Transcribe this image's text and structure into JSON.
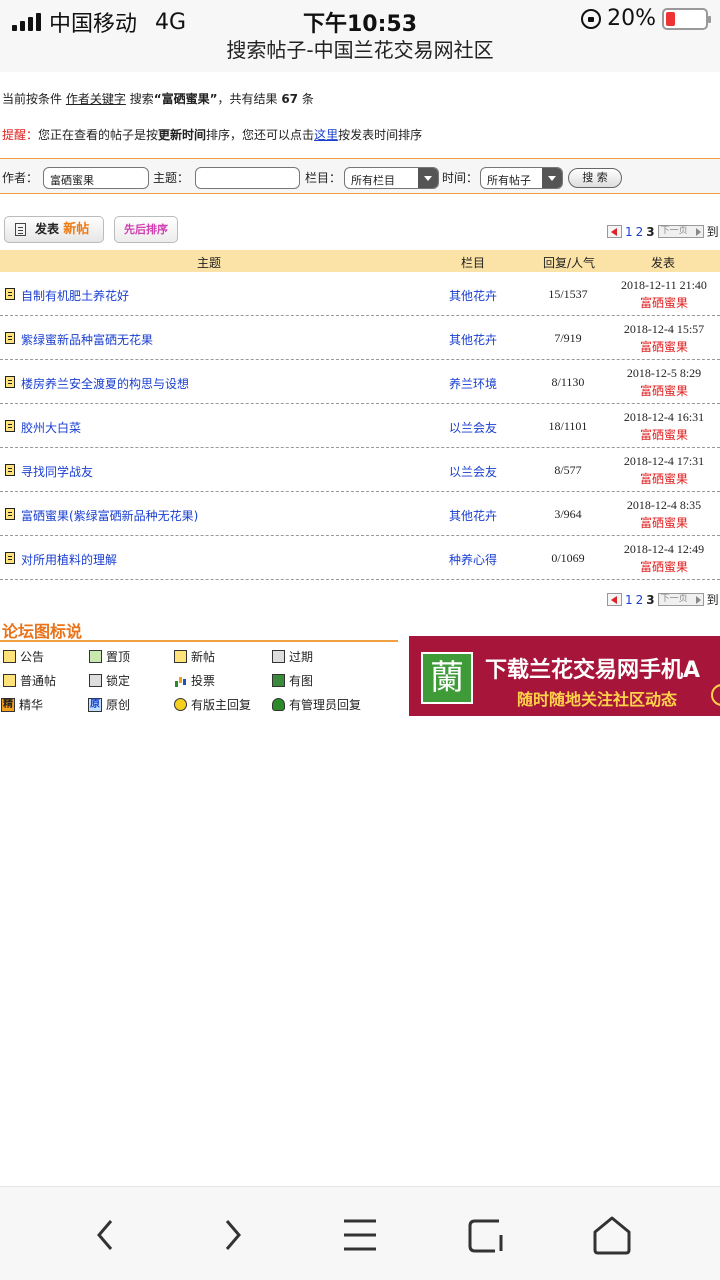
{
  "status_bar": {
    "carrier": "中国移动",
    "network": "4G",
    "time": "下午10:53",
    "battery": "20%"
  },
  "page_title": "搜索帖子-中国兰花交易网社区",
  "search_info": {
    "prefix": "当前按条件",
    "condition": "作者关键字",
    "search_word": "搜索",
    "keyword": "“富硒蜜果”",
    "result_prefix": "，共有结果",
    "count": "67",
    "unit": "条"
  },
  "tip": {
    "label": "提醒：",
    "text1": "您正在查看的帖子是按",
    "bold": "更新时间",
    "text2": "排序，您还可以点击",
    "link": "这里",
    "text3": "按发表时间排序"
  },
  "search_form": {
    "author_label": "作者：",
    "author_value": "富硒蜜果",
    "subject_label": "主题：",
    "subject_value": "",
    "column_label": "栏目：",
    "column_value": "所有栏目",
    "time_label": "时间：",
    "time_value": "所有帖子",
    "search_button": "搜 索"
  },
  "toolbar": {
    "post_label": "发表",
    "post_new": "新帖",
    "sort_label": "先后排序"
  },
  "pager": {
    "pages": [
      "1",
      "2",
      "3"
    ],
    "current": "3",
    "next_label": "下一页",
    "goto": "到"
  },
  "table": {
    "headers": {
      "subject": "主题",
      "column": "栏目",
      "stats": "回复/人气",
      "post": "发表"
    },
    "rows": [
      {
        "title": "自制有机肥土养花好",
        "column": "其他花卉",
        "stats": "15/1537",
        "date": "2018-12-11 21:40",
        "author": "富硒蜜果"
      },
      {
        "title": "紫绿蜜新品种富硒无花果",
        "column": "其他花卉",
        "stats": "7/919",
        "date": "2018-12-4 15:57",
        "author": "富硒蜜果"
      },
      {
        "title": "楼房养兰安全渡夏的构思与设想",
        "column": "养兰环境",
        "stats": "8/1130",
        "date": "2018-12-5 8:29",
        "author": "富硒蜜果"
      },
      {
        "title": "胶州大白菜",
        "column": "以兰会友",
        "stats": "18/1101",
        "date": "2018-12-4 16:31",
        "author": "富硒蜜果"
      },
      {
        "title": "寻找同学战友",
        "column": "以兰会友",
        "stats": "8/577",
        "date": "2018-12-4 17:31",
        "author": "富硒蜜果"
      },
      {
        "title": "富硒蜜果(紫绿富硒新品种无花果)",
        "column": "其他花卉",
        "stats": "3/964",
        "date": "2018-12-4 8:35",
        "author": "富硒蜜果"
      },
      {
        "title": "对所用植料的理解",
        "column": "种养心得",
        "stats": "0/1069",
        "date": "2018-12-4 12:49",
        "author": "富硒蜜果"
      }
    ]
  },
  "legend": {
    "title": "论坛图标说",
    "items": {
      "announce": "公告",
      "top": "置顶",
      "new": "新帖",
      "expired": "过期",
      "normal": "普通帖",
      "locked": "锁定",
      "vote": "投票",
      "image": "有图",
      "elite": "精华",
      "elite_mark": "精",
      "original": "原创",
      "original_mark": "原",
      "mod_reply": "有版主回复",
      "admin_reply": "有管理员回复"
    }
  },
  "banner": {
    "logo": "蘭",
    "line1": "下载兰花交易网手机A",
    "line2": "随时随地关注社区动态"
  },
  "colors": {
    "accent_orange": "#e8731a",
    "link_blue": "#1a3fd0",
    "author_red": "#e02020",
    "header_bg": "#fbe2a6",
    "banner_bg": "#a8153a"
  }
}
